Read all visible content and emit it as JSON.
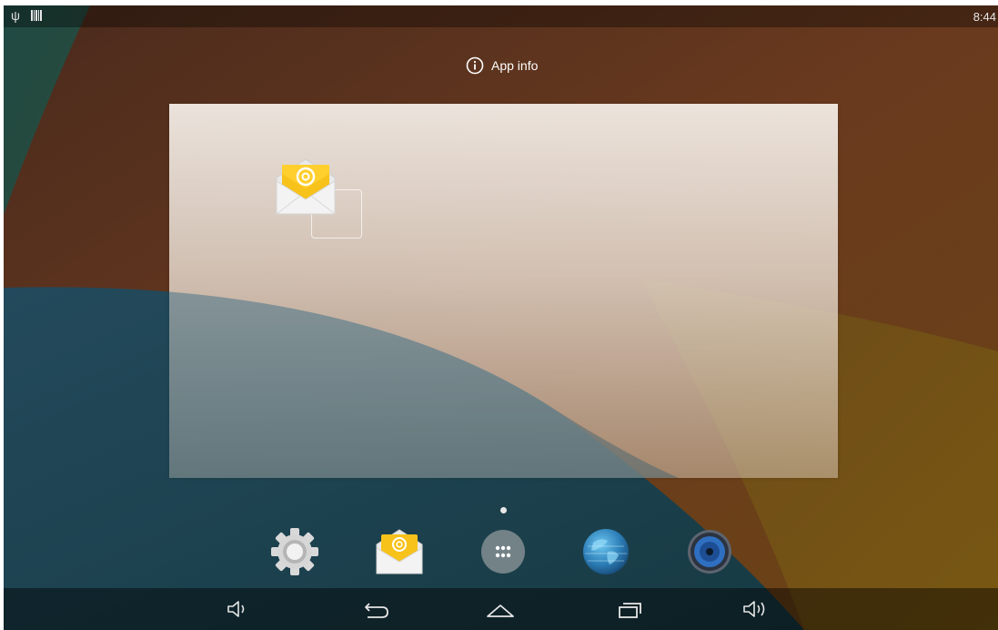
{
  "status_bar": {
    "clock": "8:44",
    "icons": [
      "usb-icon",
      "barcode-icon"
    ]
  },
  "drop_target": {
    "label": "App info",
    "icon": "info-icon"
  },
  "workspace": {
    "dragged_app": "email-icon",
    "page_count": 1,
    "current_page": 1
  },
  "dock": {
    "apps": [
      "settings-icon",
      "email-icon",
      "all-apps-icon",
      "browser-icon",
      "music-icon"
    ]
  },
  "nav_bar": {
    "buttons": [
      "volume-down-icon",
      "back-icon",
      "home-icon",
      "recents-icon",
      "volume-up-icon"
    ]
  },
  "colors": {
    "wallpaper_brown": "#5e3420",
    "wallpaper_teal": "#1f4651",
    "wallpaper_olive": "#6b4e1b",
    "panel": "#eee6de",
    "email_yellow": "#f7c21a",
    "email_orange": "#f0a000"
  }
}
